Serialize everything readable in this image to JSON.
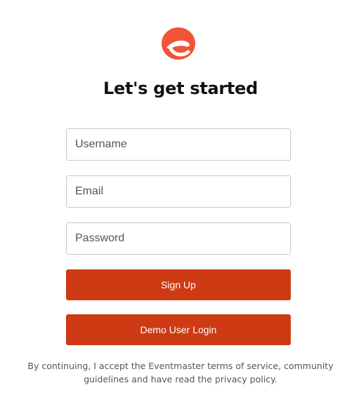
{
  "brand": {
    "logo_icon": "eventmaster-e-logo",
    "accent_color": "#f05537",
    "button_color": "#cd3a13"
  },
  "page": {
    "title": "Let's get started"
  },
  "form": {
    "username_placeholder": "Username",
    "email_placeholder": "Email",
    "password_placeholder": "Password",
    "signup_label": "Sign Up",
    "demo_label": "Demo User Login"
  },
  "footer": {
    "terms_text": "By continuing, I accept the Eventmaster terms of service, community guidelines and have read the privacy policy."
  }
}
